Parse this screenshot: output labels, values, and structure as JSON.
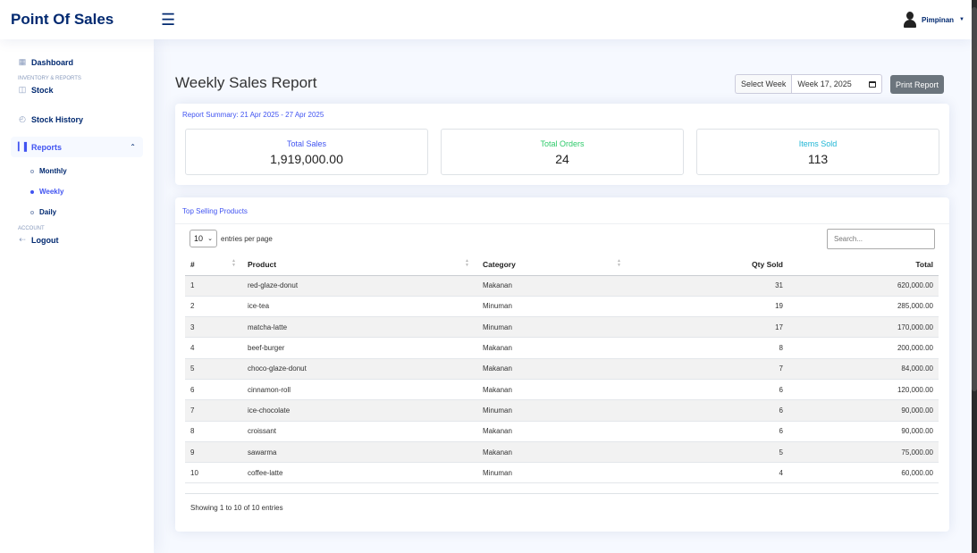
{
  "header": {
    "logo": "Point Of Sales",
    "menu_icon": "hamburger-icon",
    "user_name": "Pimpinan"
  },
  "sidebar": {
    "dashboard": "Dashboard",
    "heading_inventory": "INVENTORY & REPORTS",
    "stock": "Stock",
    "stock_history": "Stock History",
    "reports": "Reports",
    "sub": {
      "monthly": "Monthly",
      "weekly": "Weekly",
      "daily": "Daily"
    },
    "heading_account": "ACCOUNT",
    "logout": "Logout"
  },
  "page": {
    "title": "Weekly Sales Report",
    "week_label": "Select Week",
    "week_value": "Week 17, 2025",
    "print_label": "Print Report"
  },
  "summary": {
    "title": "Report Summary: 21 Apr 2025 - 27 Apr 2025",
    "stats": [
      {
        "label": "Total Sales",
        "value": "1,919,000.00",
        "color": "#4154f1"
      },
      {
        "label": "Total Orders",
        "value": "24",
        "color": "#2eca6a"
      },
      {
        "label": "Items Sold",
        "value": "113",
        "color": "#1fb6d5"
      }
    ]
  },
  "products": {
    "title": "Top Selling Products",
    "per_page_value": "10",
    "per_page_label": "entries per page",
    "search_placeholder": "Search...",
    "columns": {
      "num": "#",
      "product": "Product",
      "category": "Category",
      "qty": "Qty Sold",
      "total": "Total"
    },
    "rows": [
      {
        "num": "1",
        "product": "red-glaze-donut",
        "category": "Makanan",
        "qty": "31",
        "total": "620,000.00"
      },
      {
        "num": "2",
        "product": "ice-tea",
        "category": "Minuman",
        "qty": "19",
        "total": "285,000.00"
      },
      {
        "num": "3",
        "product": "matcha-latte",
        "category": "Minuman",
        "qty": "17",
        "total": "170,000.00"
      },
      {
        "num": "4",
        "product": "beef-burger",
        "category": "Makanan",
        "qty": "8",
        "total": "200,000.00"
      },
      {
        "num": "5",
        "product": "choco-glaze-donut",
        "category": "Makanan",
        "qty": "7",
        "total": "84,000.00"
      },
      {
        "num": "6",
        "product": "cinnamon-roll",
        "category": "Makanan",
        "qty": "6",
        "total": "120,000.00"
      },
      {
        "num": "7",
        "product": "ice-chocolate",
        "category": "Minuman",
        "qty": "6",
        "total": "90,000.00"
      },
      {
        "num": "8",
        "product": "croissant",
        "category": "Makanan",
        "qty": "6",
        "total": "90,000.00"
      },
      {
        "num": "9",
        "product": "sawarma",
        "category": "Makanan",
        "qty": "5",
        "total": "75,000.00"
      },
      {
        "num": "10",
        "product": "coffee-latte",
        "category": "Minuman",
        "qty": "4",
        "total": "60,000.00"
      }
    ],
    "info": "Showing 1 to 10 of 10 entries"
  }
}
